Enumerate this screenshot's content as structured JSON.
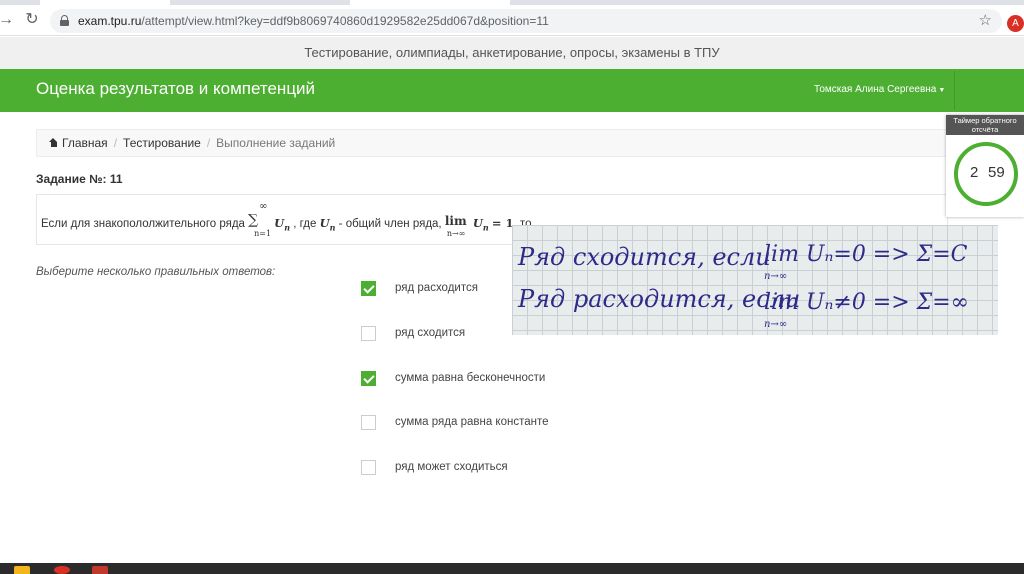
{
  "browser": {
    "url_host": "exam.tpu.ru",
    "url_path": "/attempt/view.html?key=ddf9b8069740860d1929582e25dd067d&position=11",
    "profile_initial": "A",
    "icons": {
      "back": "arrow-left-icon",
      "reload": "reload-icon",
      "lock": "lock-icon",
      "bookmark": "star-icon"
    }
  },
  "site": {
    "banner": "Тестирование, олимпиады, анкетирование, опросы, экзамены в ТПУ",
    "brand": "Оценка результатов и компетенций",
    "user_name": "Томская Алина Сергеевна",
    "accent_color": "#4caf32"
  },
  "breadcrumb": [
    "Главная",
    "Тестирование",
    "Выполнение заданий"
  ],
  "task": {
    "label": "Задание №:",
    "number": "11",
    "question_parts": {
      "prefix": "Если для знакопололжительного ряда",
      "sum_sup": "∞",
      "sum_sub": "n=1",
      "term": "U",
      "term_sub": "n",
      "mid": ", где",
      "mid2": "- общий член ряда,",
      "lim": "lim",
      "lim_sub": "n→∞",
      "eq": "= 1",
      "suffix": ", то"
    }
  },
  "instruction": "Выберите несколько правильных ответов:",
  "options": [
    {
      "label": "ряд расходится",
      "checked": true
    },
    {
      "label": "ряд сходится",
      "checked": false
    },
    {
      "label": "сумма равна бесконечности",
      "checked": true
    },
    {
      "label": "сумма ряда равна константе",
      "checked": false
    },
    {
      "label": "ряд может сходиться",
      "checked": false
    }
  ],
  "timer": {
    "title": "Таймер обратного отсчёта",
    "minutes": "2",
    "seconds": "59"
  },
  "handwritten_note": {
    "line1": "Ряд сходится, если",
    "line1_math": "lim Uₙ=0 => Σ=C",
    "line1_sub": "n→∞",
    "line2": "Ряд расходится, если",
    "line2_math": "lim Uₙ≠0 => Σ=∞",
    "line2_sub": "n→∞"
  }
}
